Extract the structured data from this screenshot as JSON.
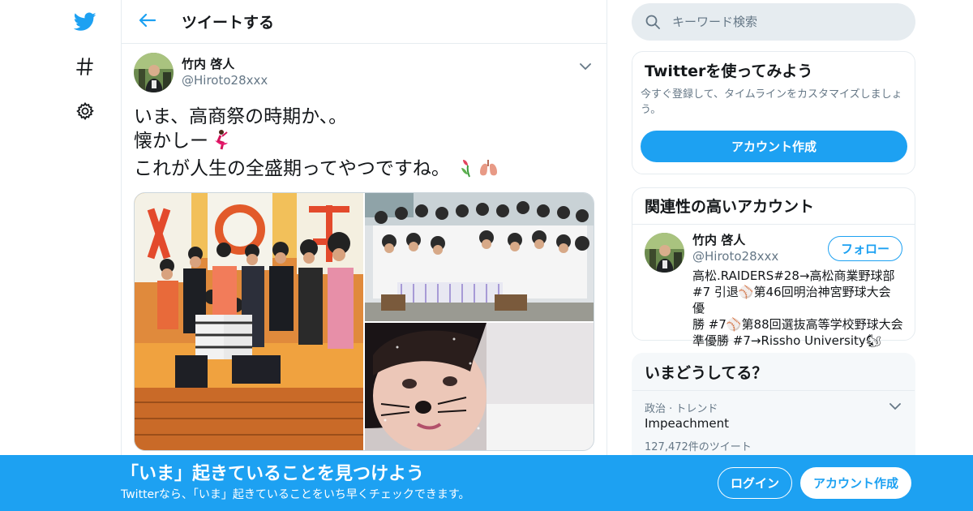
{
  "colors": {
    "brand": "#1da1f2",
    "text": "#14171a",
    "muted": "#657786",
    "border": "#e6ecf0"
  },
  "nav": {
    "items": [
      {
        "icon": "twitter-bird-icon"
      },
      {
        "icon": "hashtag-icon"
      },
      {
        "icon": "gear-icon"
      }
    ]
  },
  "header": {
    "back_icon": "arrow-left-icon",
    "title": "ツイートする"
  },
  "tweet": {
    "author_name": "竹内 啓人",
    "author_handle": "@Hiroto28xxx",
    "text_lines": [
      "いま、高商祭の時期か、。",
      "懐かしー",
      "これが人生の全盛期ってやつですね。"
    ],
    "emojis": [
      "dancer-emoji",
      "tulip-emoji",
      "lungs-emoji"
    ],
    "photos": [
      "stage-group-photo",
      "classroom-group-photo",
      "selfie-cat-filter-photo"
    ]
  },
  "search": {
    "placeholder": "キーワード検索"
  },
  "try_card": {
    "title": "Twitterを使ってみよう",
    "description": "今すぐ登録して、タイムラインをカスタマイズしましょう。",
    "button": "アカウント作成"
  },
  "related": {
    "title": "関連性の高いアカウント",
    "name": "竹内 啓人",
    "handle": "@Hiroto28xxx",
    "follow": "フォロー",
    "bio_lines": [
      "高松.RAIDERS#28→高松商業野球部",
      "#7 引退⚾第46回明治神宮野球大会 優",
      "勝 #7⚾第88回選抜高等学校野球大会",
      "準優勝 #7→Rissho University🐿"
    ]
  },
  "trends": {
    "title": "いまどうしてる？",
    "category": "政治 · トレンド",
    "name": "Impeachment",
    "count": "127,472件のツイート"
  },
  "bottom_bar": {
    "title": "「いま」起きていることを見つけよう",
    "subtitle": "Twitterなら、「いま」起きていることをいち早くチェックできます。",
    "login": "ログイン",
    "signup": "アカウント作成"
  }
}
